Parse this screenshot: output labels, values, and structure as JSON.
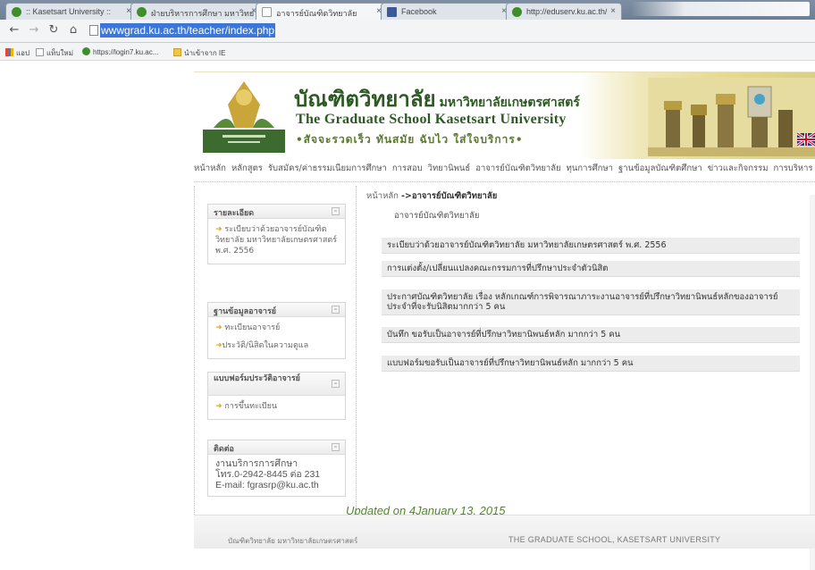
{
  "browser": {
    "tabs": [
      {
        "title": ":: Kasetsart University ::",
        "color": "#3f8e2b"
      },
      {
        "title": "ฝ่ายบริหารการศึกษา มหาวิทย",
        "color": "#3f8e2b"
      },
      {
        "title": "อาจารย์บัณฑิตวิทยาลัย",
        "color": "#bfc6cf",
        "active": true
      },
      {
        "title": "Facebook",
        "color": "#3b5998"
      },
      {
        "title": "http://eduserv.ku.ac.th/",
        "color": "#3f8e2b"
      }
    ],
    "url": "wwwgrad.ku.ac.th/teacher/index.php",
    "bookmarks": [
      "แอป",
      "แท็บใหม่",
      "https://login7.ku.ac...",
      "นำเข้าจาก IE"
    ]
  },
  "banner": {
    "thai_title": "บัณฑิตวิทยาลัย",
    "thai_subtitle": "มหาวิทยาลัยเกษตรศาสตร์",
    "english_title": "The Graduate School Kasetsart University",
    "motto": "•สัจจะรวดเร็ว ทันสมัย ฉับไว ใส่ใจบริการ•"
  },
  "topnav": [
    "หน้าหลัก",
    "หลักสูตร",
    "รับสมัคร/ค่าธรรมเนียมการศึกษา",
    "การสอบ",
    "วิทยานิพนธ์",
    "อาจารย์บัณฑิตวิทยาลัย",
    "ทุนการศึกษา",
    "ฐานข้อมูลบัณฑิตศึกษา",
    "ข่าวและกิจกรรม",
    "การบริหาร"
  ],
  "sidebar": {
    "box1": {
      "title": "รายละเอียด",
      "links": [
        "ระเบียบว่าด้วยอาจารย์บัณฑิตวิทยาลัย มหาวิทยาลัยเกษตรศาสตร์ พ.ศ. 2556"
      ]
    },
    "box2": {
      "title": "ฐานข้อมูลอาจารย์",
      "links": [
        "ทะเบียนอาจารย์",
        "ประวัติ/นิสิตในความดูแล"
      ]
    },
    "box3": {
      "title": "แบบฟอร์มประวัติอาจารย์",
      "links": [
        "การขึ้นทะเบียน"
      ]
    },
    "box4": {
      "title": "ติดต่อ",
      "lines": [
        "งานบริการการศึกษา",
        "โทร.0-2942-8445 ต่อ 231",
        "E-mail: fgrasrp@ku.ac.th"
      ]
    }
  },
  "main": {
    "breadcrumb_home": "หน้าหลัก",
    "breadcrumb_arrow": "->",
    "breadcrumb_current": "อาจารย์บัณฑิตวิทยาลัย",
    "heading": "อาจารย์บัณฑิตวิทยาลัย",
    "items": [
      "ระเบียบว่าด้วยอาจารย์บัณฑิตวิทยาลัย มหาวิทยาลัยเกษตรศาสตร์ พ.ศ. 2556",
      "การแต่งตั้ง/เปลี่ยนแปลงคณะกรรมการที่ปรึกษาประจำตัวนิสิต",
      "ประกาศบัณฑิตวิทยาลัย เรื่อง หลักเกณฑ์การพิจารณาภาระงานอาจารย์ที่ปรึกษาวิทยานิพนธ์หลักของอาจารย์ประจำที่จะรับนิสิตมากกว่า 5 คน",
      "บันทึก ขอรับเป็นอาจารย์ที่ปรึกษาวิทยานิพนธ์หลัก มากกว่า 5 คน",
      "แบบฟอร์มขอรับเป็นอาจารย์ที่ปรึกษาวิทยานิพนธ์หลัก มากกว่า 5 คน"
    ],
    "updated": "Updated on 4January 13, 2015"
  },
  "footer": {
    "left": "บัณฑิตวิทยาลัย มหาวิทยาลัยเกษตรศาสตร์",
    "right": "THE GRADUATE SCHOOL, KASETSART UNIVERSITY"
  },
  "colors": {
    "brand_green": "#2c5a22",
    "updated_green": "#4e8a26",
    "url_selection": "#3c77d8",
    "arrow_orange": "#e8a21b"
  }
}
